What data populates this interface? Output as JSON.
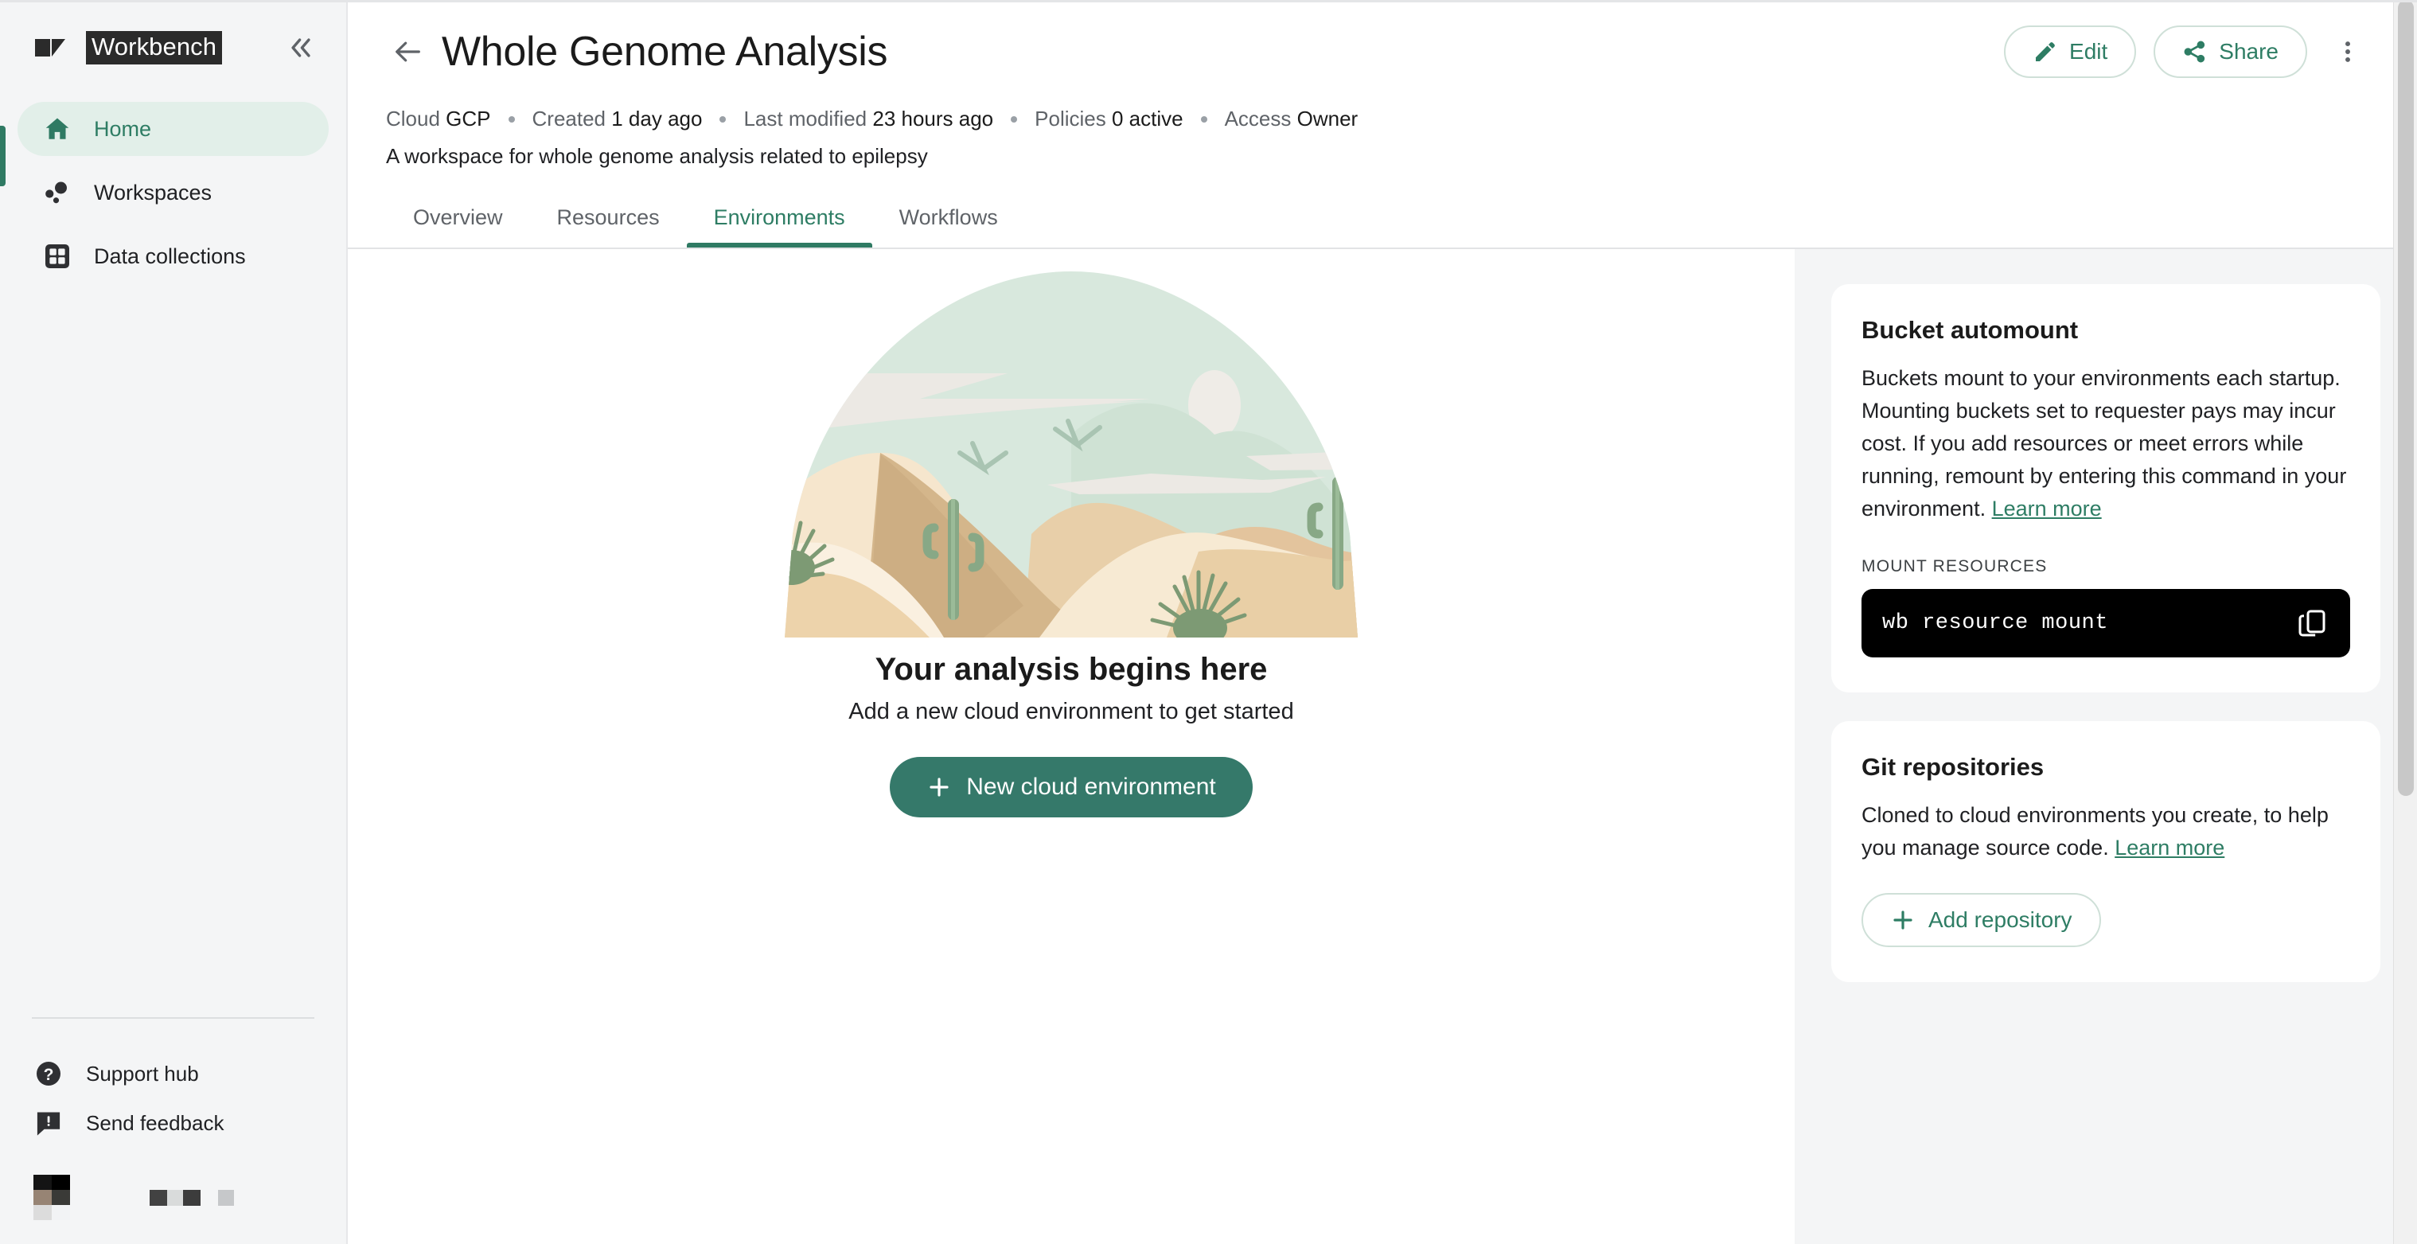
{
  "sidebar": {
    "brand": {
      "name": "Workbench",
      "logo_icon": "workbench-logo-icon"
    },
    "collapse_label": "«",
    "items": [
      {
        "label": "Home",
        "icon": "home-icon",
        "active": true
      },
      {
        "label": "Workspaces",
        "icon": "workspaces-dots-icon",
        "active": false
      },
      {
        "label": "Data collections",
        "icon": "grid-icon",
        "active": false
      }
    ],
    "footer_items": [
      {
        "label": "Support hub",
        "icon": "question-mark-circle-icon"
      },
      {
        "label": "Send feedback",
        "icon": "feedback-chat-icon"
      }
    ],
    "user": {
      "avatar_icon": "avatar-pixelated",
      "name_redacted": true
    }
  },
  "header": {
    "back_icon": "arrow-left-icon",
    "title": "Whole Genome Analysis",
    "edit_label": "Edit",
    "edit_icon": "pencil-icon",
    "share_label": "Share",
    "share_icon": "share-nodes-icon",
    "more_icon": "kebab-menu-icon",
    "meta": [
      {
        "key": "Cloud",
        "value": "GCP"
      },
      {
        "key": "Created",
        "value": "1 day ago"
      },
      {
        "key": "Last modified",
        "value": "23 hours ago"
      },
      {
        "key": "Policies",
        "value": "0 active"
      },
      {
        "key": "Access",
        "value": "Owner"
      }
    ],
    "description": "A workspace for whole genome analysis related to epilepsy"
  },
  "tabs": [
    {
      "label": "Overview",
      "active": false
    },
    {
      "label": "Resources",
      "active": false
    },
    {
      "label": "Environments",
      "active": true
    },
    {
      "label": "Workflows",
      "active": false
    }
  ],
  "empty_state": {
    "illustration": "desert-dunes-cactus-arch-illustration",
    "title": "Your analysis begins here",
    "subtitle": "Add a new cloud environment to get started",
    "cta_label": "New cloud environment",
    "cta_icon": "plus-icon"
  },
  "right_panel": {
    "bucket_card": {
      "title": "Bucket automount",
      "body": "Buckets mount to your environments each startup. Mounting buckets set to requester pays may incur cost. If you add resources or meet errors while running, remount by entering this command in your environment. ",
      "link_label": "Learn more",
      "sublabel": "MOUNT RESOURCES",
      "command": "wb resource mount",
      "copy_icon": "copy-icon"
    },
    "git_card": {
      "title": "Git repositories",
      "body": "Cloned to cloud environments you create, to help you manage source code. ",
      "link_label": "Learn more",
      "button_label": "Add repository",
      "button_icon": "plus-icon"
    }
  },
  "colors": {
    "accent_green": "#2f7a63",
    "cta_green": "#35796a",
    "sidebar_bg": "#f4f5f6",
    "active_nav_bg": "#e2efe9",
    "panel_bg": "#f4f5f6",
    "command_bg": "#000000"
  }
}
